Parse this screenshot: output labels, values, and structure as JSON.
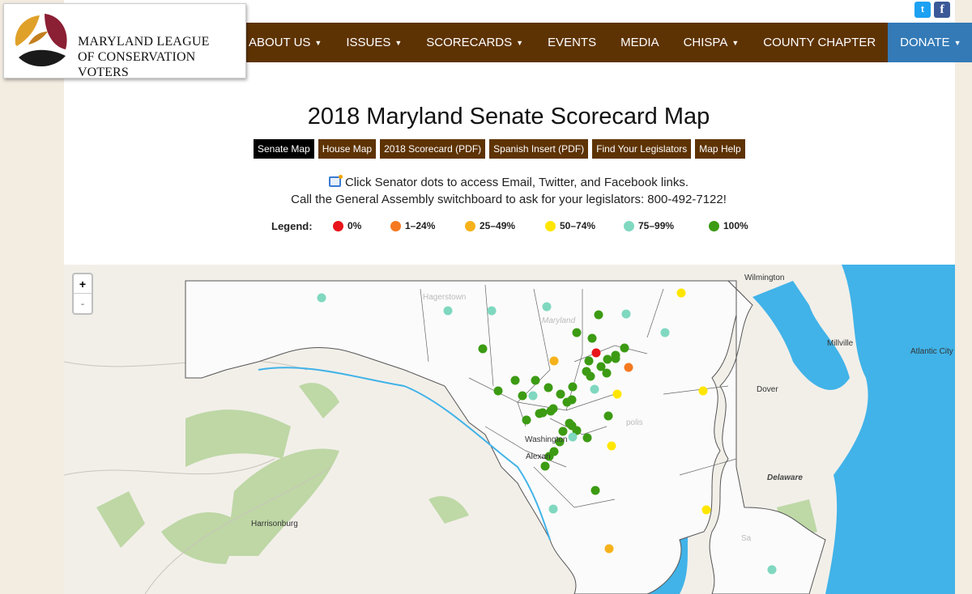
{
  "header": {
    "org_name_line1": "Maryland League",
    "org_name_line2": "of Conservation Voters",
    "social": {
      "twitter_icon": "twitter-icon",
      "facebook_icon": "facebook-icon"
    }
  },
  "nav": {
    "items": [
      {
        "label": "ABOUT US",
        "dropdown": true
      },
      {
        "label": "ISSUES",
        "dropdown": true
      },
      {
        "label": "SCORECARDS",
        "dropdown": true
      },
      {
        "label": "EVENTS",
        "dropdown": false
      },
      {
        "label": "MEDIA",
        "dropdown": false
      },
      {
        "label": "CHISPA",
        "dropdown": true
      },
      {
        "label": "COUNTY CHAPTER",
        "dropdown": false
      }
    ],
    "donate_label": "DONATE",
    "colors": {
      "bar": "#5e3304",
      "donate": "#337ab7"
    }
  },
  "main": {
    "title": "2018 Maryland Senate Scorecard Map",
    "buttons": [
      {
        "label": "Senate Map",
        "active": true
      },
      {
        "label": "House Map",
        "active": false
      },
      {
        "label": "2018 Scorecard (PDF)",
        "active": false
      },
      {
        "label": "Spanish Insert (PDF)",
        "active": false
      },
      {
        "label": "Find Your Legislators",
        "active": false
      },
      {
        "label": "Map Help",
        "active": false
      }
    ],
    "info_line1": "Click Senator dots to access Email, Twitter, and Facebook links.",
    "info_line2": "Call the General Assembly switchboard to ask for your legislators: 800-492-7122!"
  },
  "legend": {
    "title": "Legend:",
    "items": [
      {
        "label": "0%",
        "color": "#e8141b"
      },
      {
        "label": "1–24%",
        "color": "#f47920"
      },
      {
        "label": "25–49%",
        "color": "#f6b21b"
      },
      {
        "label": "50–74%",
        "color": "#ffe600"
      },
      {
        "label": "75–99%",
        "color": "#7fd8bf"
      },
      {
        "label": "100%",
        "color": "#3c9b13"
      }
    ]
  },
  "map": {
    "zoom_in": "+",
    "zoom_out": "-",
    "labels": [
      "Wilmington",
      "Millville",
      "Atlantic City",
      "Dover",
      "Delaware",
      "Harrisonburg",
      "Hagerstown",
      "Maryland",
      "Washington",
      "Alexan",
      "polis",
      "Sa"
    ]
  }
}
